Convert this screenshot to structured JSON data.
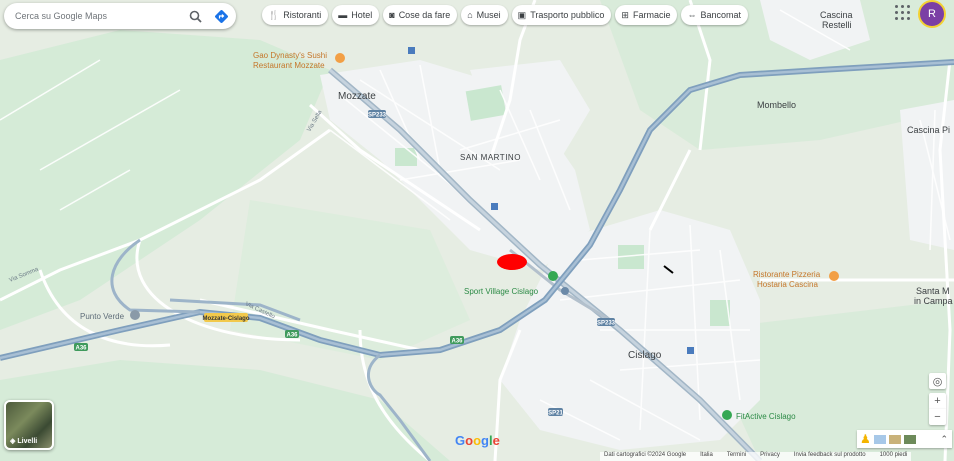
{
  "search": {
    "placeholder": "Cerca su Google Maps"
  },
  "chips": [
    {
      "icon": "fork-knife-icon",
      "label": "Ristoranti"
    },
    {
      "icon": "bed-icon",
      "label": "Hotel"
    },
    {
      "icon": "camera-icon",
      "label": "Cose da fare"
    },
    {
      "icon": "museum-icon",
      "label": "Musei"
    },
    {
      "icon": "train-icon",
      "label": "Trasporto pubblico"
    },
    {
      "icon": "pharmacy-icon",
      "label": "Farmacie"
    },
    {
      "icon": "atm-icon",
      "label": "Bancomat"
    }
  ],
  "user": {
    "initial": "R",
    "avatar_color": "#7b3fa5"
  },
  "places": {
    "mozzate": "Mozzate",
    "san_martino": "SAN MARTINO",
    "cislago": "Cislago",
    "mombello": "Mombello",
    "cascina_restelli": "Cascina Restelli",
    "cascina_pi": "Cascina Pi",
    "santa_maria": "Santa M",
    "in_campa": "in Campa",
    "punto_verde": "Punto Verde"
  },
  "pois": {
    "sushi_line1": "Gao Dynasty's Sushi",
    "sushi_line2": "Restaurant Mozzate",
    "pizzeria_line1": "Ristorante Pizzeria",
    "pizzeria_line2": "Hostaria Cascina",
    "sport_village": "Sport Village Cislago",
    "fitactive": "FitActive Cislago"
  },
  "road_labels": {
    "sp233": "SP233",
    "sp233b": "SP233",
    "sp21": "SP21",
    "a36_1": "A36",
    "a36_2": "A36",
    "a36_3": "A36",
    "exit": "Mozzate-Cislago",
    "via_sella": "Via Sella",
    "via_somma": "Via Somma",
    "via_castello": "Via Castello"
  },
  "layers": {
    "label": "Livelli"
  },
  "logo": "Google",
  "footer": {
    "data": "Dati cartografici ©2024 Google",
    "italy": "Italia",
    "terms": "Termini",
    "privacy": "Privacy",
    "feedback": "Invia feedback sul prodotto",
    "scale": "1000 piedi"
  },
  "controls": {
    "zoom_in": "+",
    "zoom_out": "−"
  },
  "colors": {
    "land": "#e8eee5",
    "green": "#c9e7cf",
    "urban": "#f1f3f4",
    "highway": "#8aa9c4",
    "marker": "#ff0000"
  }
}
